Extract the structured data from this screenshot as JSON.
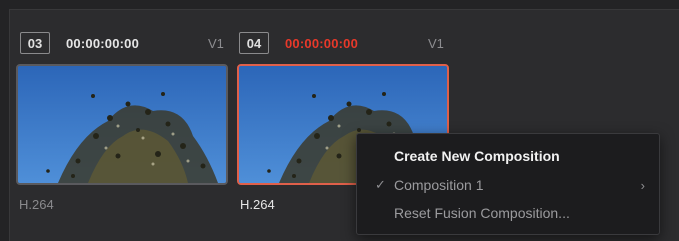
{
  "clips": [
    {
      "number": "03",
      "timecode": "00:00:00:00",
      "track": "V1",
      "codec": "H.264",
      "selected": false,
      "thumbnail_icon": "tree-sky-thumbnail"
    },
    {
      "number": "04",
      "timecode": "00:00:00:00",
      "track": "V1",
      "codec": "H.264",
      "selected": true,
      "thumbnail_icon": "tree-sky-thumbnail"
    }
  ],
  "context_menu": {
    "items": [
      {
        "label": "Create New Composition",
        "checked": false,
        "submenu": false,
        "highlighted": true
      },
      {
        "label": "Composition 1",
        "checked": true,
        "submenu": true,
        "highlighted": false
      },
      {
        "label": "Reset Fusion Composition...",
        "checked": false,
        "submenu": false,
        "highlighted": false
      }
    ],
    "check_glyph": "✓",
    "chevron_glyph": "›"
  },
  "colors": {
    "active_timecode": "#e8392a",
    "selection_border": "#e0604a",
    "panel_background": "#2c2c2e",
    "menu_background": "#1c1c1e"
  }
}
